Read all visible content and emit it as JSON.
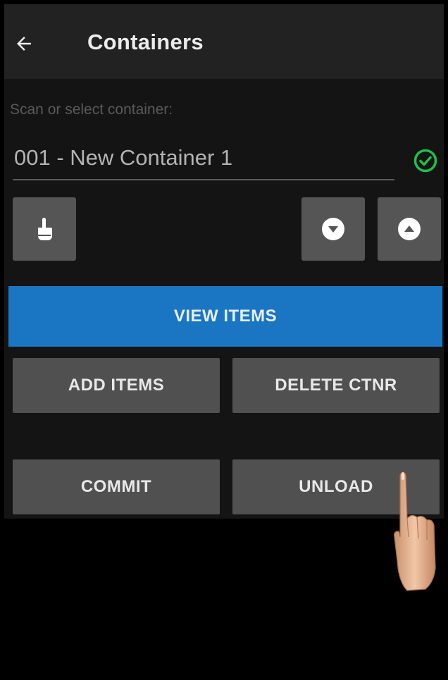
{
  "header": {
    "title": "Containers",
    "back_icon": "arrow-left-icon"
  },
  "scan": {
    "label": "Scan or select container:",
    "value": "001 - New Container 1",
    "status_icon": "check-circle-icon",
    "status_color": "#1fc14a"
  },
  "tool_buttons": {
    "manual_icon": "hand-pointer-icon",
    "down_icon": "chevron-down-circle-icon",
    "up_icon": "chevron-up-circle-icon"
  },
  "actions": {
    "view_items": "VIEW ITEMS",
    "add_items": "ADD ITEMS",
    "delete_ctnr": "DELETE CTNR",
    "commit": "COMMIT",
    "unload": "UNLOAD"
  },
  "colors": {
    "appbar": "#222222",
    "primary": "#1a76c2",
    "button": "#505050",
    "background": "#141414"
  }
}
